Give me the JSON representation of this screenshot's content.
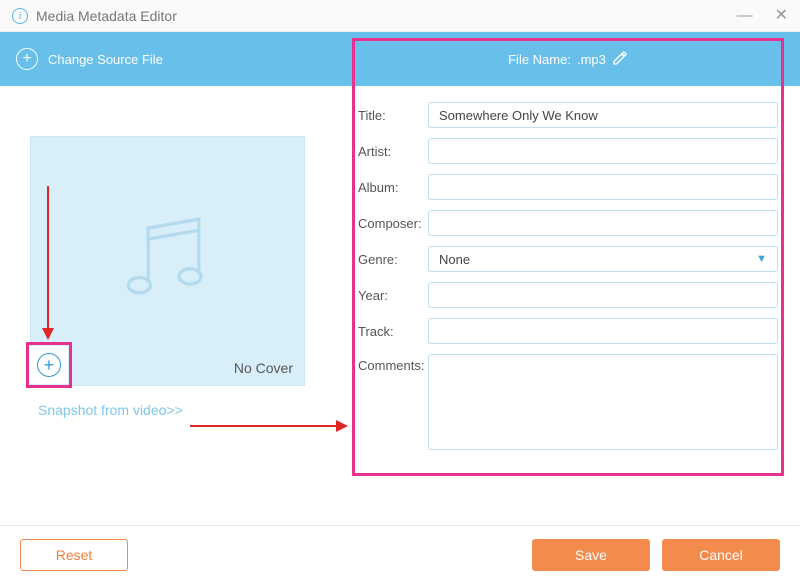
{
  "window": {
    "title": "Media Metadata Editor"
  },
  "toolbar": {
    "change_source": "Change Source File",
    "file_name_label": "File Name:",
    "file_name_value": ".mp3"
  },
  "cover": {
    "no_cover_text": "No Cover",
    "snapshot_link": "Snapshot from video>>"
  },
  "form": {
    "labels": {
      "title": "Title:",
      "artist": "Artist:",
      "album": "Album:",
      "composer": "Composer:",
      "genre": "Genre:",
      "year": "Year:",
      "track": "Track:",
      "comments": "Comments:"
    },
    "values": {
      "title": "Somewhere Only We Know",
      "artist": "",
      "album": "",
      "composer": "",
      "genre": "None",
      "year": "",
      "track": "",
      "comments": ""
    }
  },
  "footer": {
    "reset": "Reset",
    "save": "Save",
    "cancel": "Cancel"
  }
}
